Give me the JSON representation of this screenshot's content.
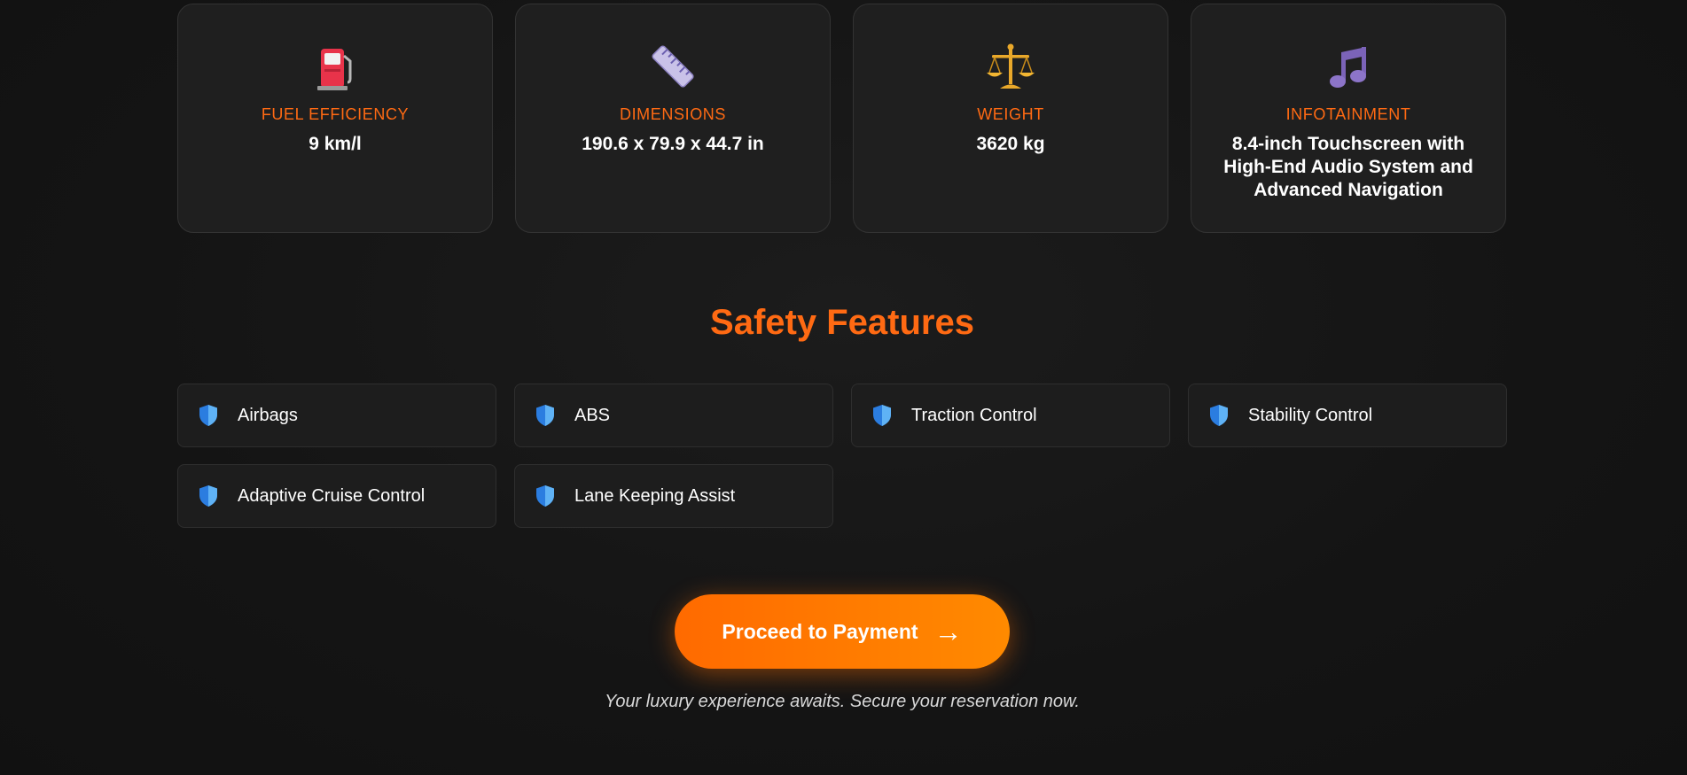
{
  "specs": [
    {
      "icon": "fuel-pump-icon",
      "label": "FUEL EFFICIENCY",
      "value": "9 km/l"
    },
    {
      "icon": "ruler-icon",
      "label": "DIMENSIONS",
      "value": "190.6 x 79.9 x 44.7 in"
    },
    {
      "icon": "balance-scale-icon",
      "label": "WEIGHT",
      "value": "3620 kg"
    },
    {
      "icon": "music-note-icon",
      "label": "INFOTAINMENT",
      "value": "8.4-inch Touchscreen with High-End Audio System and Advanced Navigation"
    }
  ],
  "safety": {
    "title": "Safety Features",
    "icon": "shield-icon",
    "items": [
      "Airbags",
      "ABS",
      "Traction Control",
      "Stability Control",
      "Adaptive Cruise Control",
      "Lane Keeping Assist"
    ]
  },
  "cta": {
    "label": "Proceed to Payment",
    "arrow": "→",
    "caption": "Your luxury experience awaits. Secure your reservation now."
  },
  "colors": {
    "accent": "#ff6a13",
    "background": "#141414",
    "card": "#1f1f1f",
    "shield": "#3a8eea"
  }
}
